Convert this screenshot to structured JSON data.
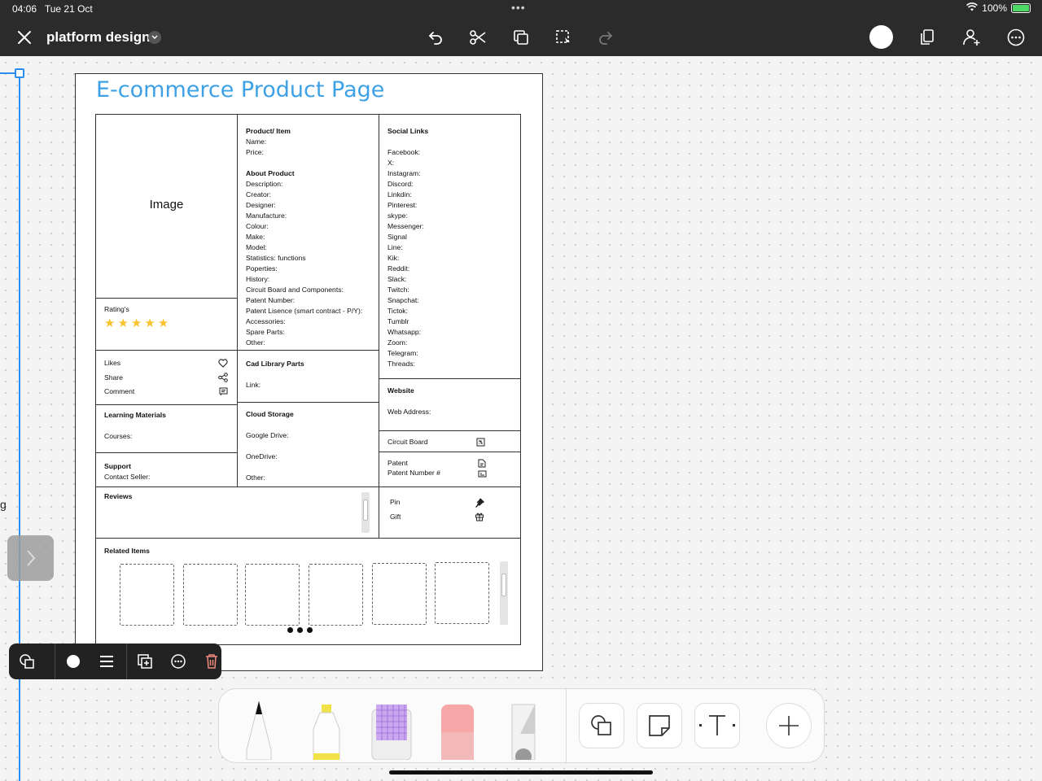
{
  "status": {
    "time": "04:06",
    "date": "Tue 21 Oct",
    "battery": "100%"
  },
  "toolbar": {
    "doc_title": "platform design"
  },
  "colors": {
    "accent": "#3ea1e6",
    "selection": "#2a8ef0",
    "star": "#f7c32e",
    "toolbar_bg": "#2b2b2b"
  },
  "side": {
    "glyph": "g"
  },
  "wireframe": {
    "title": "E-commerce Product Page",
    "image_label": "Image",
    "ratings": {
      "label": "Rating's",
      "stars": 5
    },
    "engagement": {
      "likes": "Likes",
      "share": "Share",
      "comment": "Comment"
    },
    "learning": {
      "heading": "Learning Materials",
      "courses": "Courses:"
    },
    "support": {
      "heading": "Support",
      "contact": "Contact Seller:"
    },
    "reviews": {
      "heading": "Reviews"
    },
    "product": {
      "heading": "Product/ Item",
      "name": "Name:",
      "price": "Price:",
      "about_heading": "About Product",
      "fields": [
        "Description:",
        "Creator:",
        "Designer:",
        "Manufacture:",
        "Colour:",
        "Make:",
        "Model:",
        "Statistics: functions",
        "Poperties:",
        "History:",
        "Circuit Board and Components:",
        "Patent Number:",
        "Patent Lisence (smart contract - P/Y):",
        "Accessories:",
        "Spare Parts:",
        "Other:"
      ]
    },
    "cad": {
      "heading": "Cad Library Parts",
      "link": "Link:"
    },
    "cloud": {
      "heading": "Cloud Storage",
      "google": "Google Drive:",
      "onedrive": "OneDrive:",
      "other": "Other:"
    },
    "social": {
      "heading": "Social Links",
      "links": [
        "Facebook:",
        "X:",
        "Instagram:",
        "Discord:",
        "Linkdin:",
        "Pinterest:",
        "skype:",
        "Messenger:",
        "Signal",
        "Line:",
        "Kik:",
        "Reddit:",
        "Slack:",
        "Twitch:",
        "Snapchat:",
        "Tictok:",
        "Tumblr",
        "Whatsapp:",
        "Zoom:",
        "Telegram:",
        "Threads:"
      ]
    },
    "website": {
      "heading": "Website",
      "address": "Web Address:"
    },
    "circuit": {
      "label": "Circuit Board"
    },
    "patent": {
      "label": "Patent",
      "number": "Patent Number #"
    },
    "pin_gift": {
      "pin": "Pin",
      "gift": "Gift"
    },
    "related": {
      "heading": "Related Items",
      "tile_count": 6
    }
  }
}
